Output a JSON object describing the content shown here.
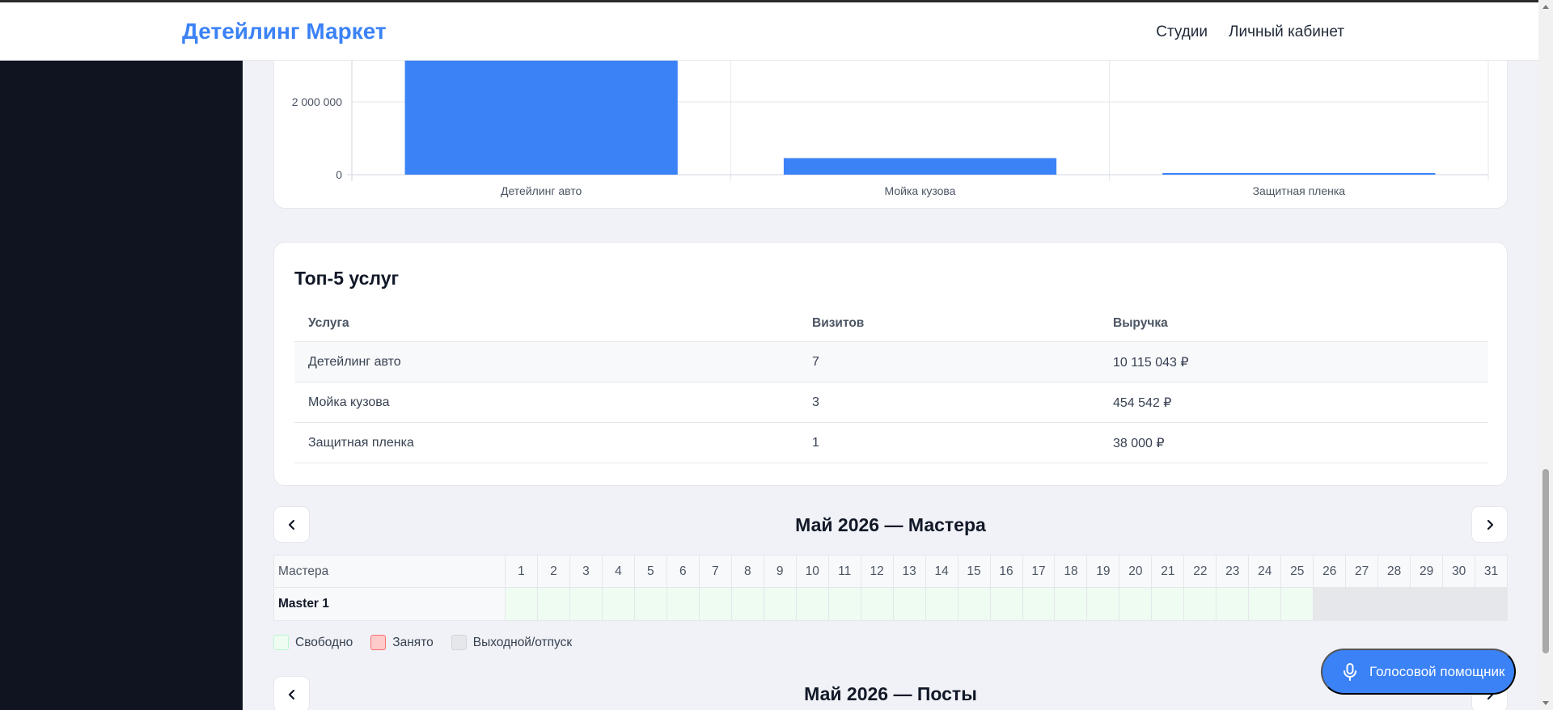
{
  "header": {
    "brand": "Детейлинг Маркет",
    "nav": [
      "Студии",
      "Личный кабинет"
    ]
  },
  "chart_data": {
    "type": "bar",
    "categories": [
      "Детейлинг авто",
      "Мойка кузова",
      "Защитная пленка"
    ],
    "values": [
      10115043,
      454542,
      38000
    ],
    "y_ticks_visible": [
      "0",
      "2 000 000"
    ],
    "ylim": [
      0,
      12000000
    ],
    "grid": true,
    "color": "#3b82f6"
  },
  "top5": {
    "title": "Топ-5 услуг",
    "columns": [
      "Услуга",
      "Визитов",
      "Выручка"
    ],
    "rows": [
      [
        "Детейлинг авто",
        "7",
        "10 115 043 ₽"
      ],
      [
        "Мойка кузова",
        "3",
        "454 542 ₽"
      ],
      [
        "Защитная пленка",
        "1",
        "38 000 ₽"
      ]
    ]
  },
  "masters_calendar": {
    "title": "Май 2026 — Мастера",
    "label_header": "Мастера",
    "days": [
      "1",
      "2",
      "3",
      "4",
      "5",
      "6",
      "7",
      "8",
      "9",
      "10",
      "11",
      "12",
      "13",
      "14",
      "15",
      "16",
      "17",
      "18",
      "19",
      "20",
      "21",
      "22",
      "23",
      "24",
      "25",
      "26",
      "27",
      "28",
      "29",
      "30",
      "31"
    ],
    "rows": [
      {
        "name": "Master 1",
        "status": [
          "free",
          "free",
          "free",
          "free",
          "free",
          "free",
          "free",
          "free",
          "free",
          "free",
          "free",
          "free",
          "free",
          "free",
          "free",
          "free",
          "free",
          "free",
          "free",
          "free",
          "free",
          "free",
          "free",
          "free",
          "free",
          "off",
          "off",
          "off",
          "off",
          "off",
          "off"
        ]
      }
    ]
  },
  "legend": [
    {
      "label": "Свободно",
      "color": "#eefcf2",
      "border": "#bbf7d0"
    },
    {
      "label": "Занято",
      "color": "#fecaca",
      "border": "#f87171"
    },
    {
      "label": "Выходной/отпуск",
      "color": "#e5e7eb",
      "border": "#d1d5db"
    }
  ],
  "posts_calendar": {
    "title": "Май 2026 — Посты"
  },
  "voice_assistant": {
    "label": "Голосовой помощник"
  },
  "colors": {
    "accent": "#3b82f6",
    "sidebar": "#0f1420",
    "content_bg": "#f0f2f7"
  }
}
